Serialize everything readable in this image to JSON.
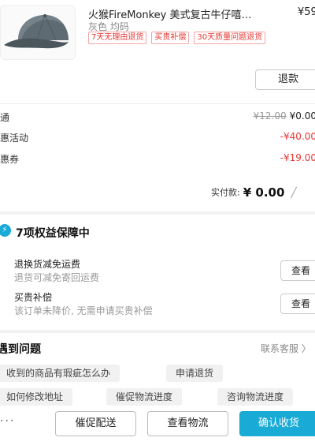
{
  "product": {
    "name": "火猴FireMonkey 美式复古牛仔嘻…",
    "price": "¥59",
    "spec": "灰色 均码",
    "tags": [
      "7天无理由退货",
      "买贵补偿",
      "30天质量问题退货"
    ],
    "refund_label": "退款"
  },
  "pricing": {
    "rows": [
      {
        "label": "通",
        "original": "¥12.00",
        "value": "¥0.00"
      },
      {
        "label": "惠活动",
        "value": "-¥40.00"
      },
      {
        "label": "惠券",
        "value": "-¥19.00"
      }
    ],
    "paid_label": "实付款:",
    "paid_value": "¥ 0.00"
  },
  "guarantee": {
    "title": "7项权益保障中",
    "icon": "bolt-icon",
    "items": [
      {
        "title": "退换货减免运费",
        "subtitle": "退货可减免寄回运费",
        "button": "查看"
      },
      {
        "title": "买贵补偿",
        "subtitle": "该订单未降价, 无需申请买贵补偿",
        "button": "查看"
      }
    ]
  },
  "problems": {
    "title": "遇到问题",
    "service_label": "联系客服 〉",
    "chips": [
      "收到的商品有瑕疵怎么办",
      "申请退货",
      "如何修改地址",
      "催促物流进度",
      "咨询物流进度"
    ]
  },
  "actions": {
    "more": "···",
    "urge": "催促配送",
    "logistics": "查看物流",
    "confirm": "确认收货"
  },
  "colors": {
    "accent": "#1aaad6",
    "discount": "#e53935"
  }
}
